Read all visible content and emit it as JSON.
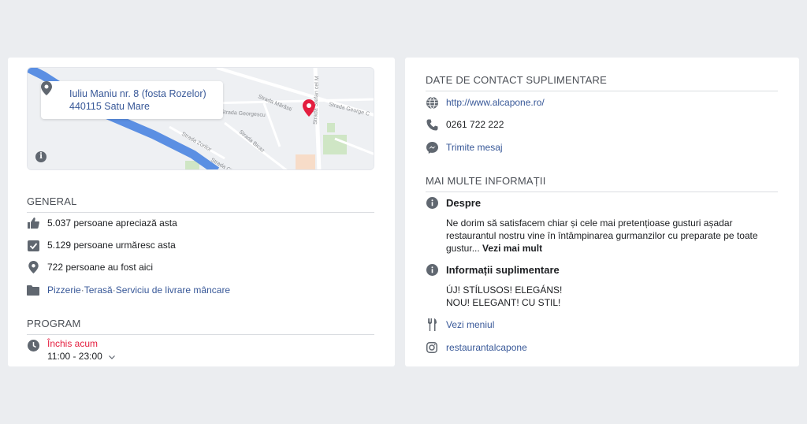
{
  "left": {
    "map": {
      "address": "Iuliu Maniu nr. 8 (fosta Rozelor) 440115 Satu Mare",
      "info_icon": "info-icon",
      "street_labels": [
        "Strada Mărăsti",
        "Strada George Coșbuc",
        "Strada Georgescu",
        "Strada Bicaz",
        "Strada Zorilor",
        "Strada Stefan cel Mare",
        "Strada Ciucea"
      ]
    },
    "general": {
      "title": "GENERAL",
      "likes": "5.037 persoane apreciază asta",
      "follows": "5.129 persoane urmăresc asta",
      "checkins": "722 persoane au fost aici",
      "categories": [
        "Pizzerie",
        "Terasă",
        "Serviciu de livrare mâncare"
      ],
      "category_sep": " · "
    },
    "program": {
      "title": "PROGRAM",
      "status": "Închis acum",
      "hours": "11:00 - 23:00"
    }
  },
  "right": {
    "contact": {
      "title": "DATE DE CONTACT SUPLIMENTARE",
      "website": "http://www.alcapone.ro/",
      "phone": "0261 722 222",
      "message": "Trimite mesaj"
    },
    "more": {
      "title": "MAI MULTE INFORMAȚII",
      "about_title": "Despre",
      "about_text": "Ne dorim să satisfacem chiar și cele mai pretențioase gusturi așadar restaurantul nostru vine în întâmpinarea gurmanzilor cu preparate pe toate gustur...",
      "see_more": "Vezi mai mult",
      "extra_title": "Informații suplimentare",
      "extra_line1": "ÚJ! STÍLUSOS! ELEGÁNS!",
      "extra_line2": "NOU! ELEGANT! CU STIL!",
      "menu": "Vezi meniul",
      "instagram": "restaurantalcapone"
    }
  },
  "colors": {
    "link": "#385898",
    "closed": "#e41e3f",
    "icon": "#606770",
    "background": "#ebedf0",
    "map_marker": "#e41e3f",
    "map_river": "#5b8fe3"
  }
}
